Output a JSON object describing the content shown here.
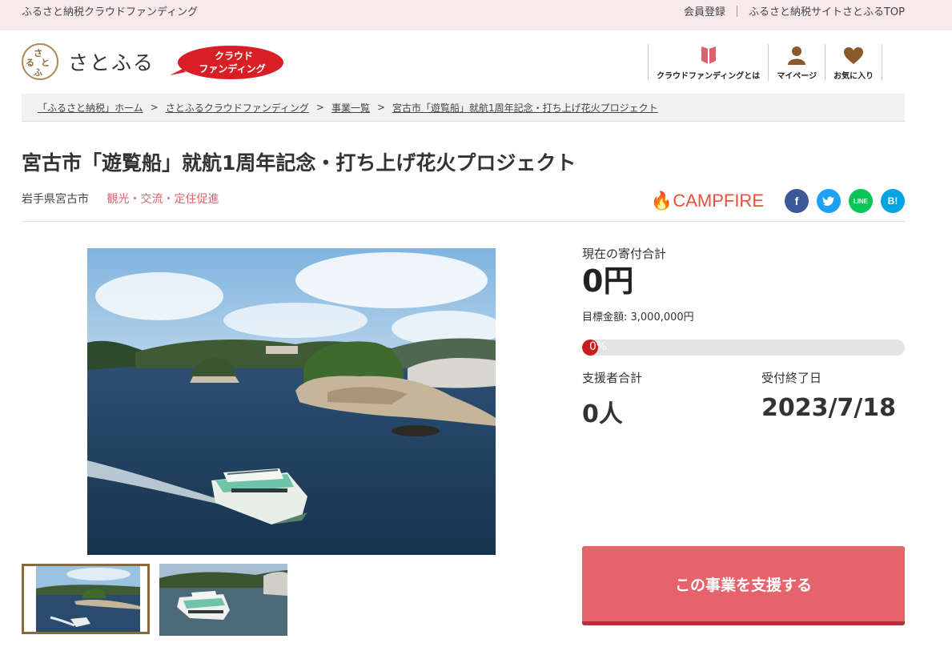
{
  "topbar": {
    "site_name": "ふるさと納税クラウドファンディング",
    "register": "会員登録",
    "furusato_top": "ふるさと納税サイトさとふるTOP"
  },
  "header": {
    "logo_text": "さとふる",
    "logo_mark": [
      "さ",
      "と",
      "ふ",
      "る"
    ],
    "badge_line1": "クラウド",
    "badge_line2": "ファンディング",
    "nav": [
      {
        "label": "クラウドファンディングとは",
        "icon": "book-icon"
      },
      {
        "label": "マイページ",
        "icon": "user-icon"
      },
      {
        "label": "お気に入り",
        "icon": "heart-icon"
      }
    ]
  },
  "breadcrumb": [
    "「ふるさと納税」ホーム",
    "さとふるクラウドファンディング",
    "事業一覧",
    "宮古市「遊覧船」就航1周年記念・打ち上げ花火プロジェクト"
  ],
  "project": {
    "title": "宮古市「遊覧船」就航1周年記念・打ち上げ花火プロジェクト",
    "prefecture": "岩手県宮古市",
    "category": "観光・交流・定住促進"
  },
  "share": {
    "campfire": "CAMPFIRE",
    "line": "LINE",
    "hatena": "B!"
  },
  "stats": {
    "total_label": "現在の寄付合計",
    "total_value": "0円",
    "goal": "目標金額: 3,000,000円",
    "progress_text": "0%",
    "supporters_label": "支援者合計",
    "supporters_value": "0人",
    "deadline_label": "受付終了日",
    "deadline_value": "2023/7/18"
  },
  "support_button": "この事業を支援する",
  "colors": {
    "accent": "#e5646b",
    "topbar_bg": "#f8e9ec",
    "category": "#d9636d",
    "progress": "#c71d1d",
    "facebook": "#3b5998",
    "twitter": "#1da1f2",
    "line": "#06c755",
    "hatena": "#00a4de"
  }
}
